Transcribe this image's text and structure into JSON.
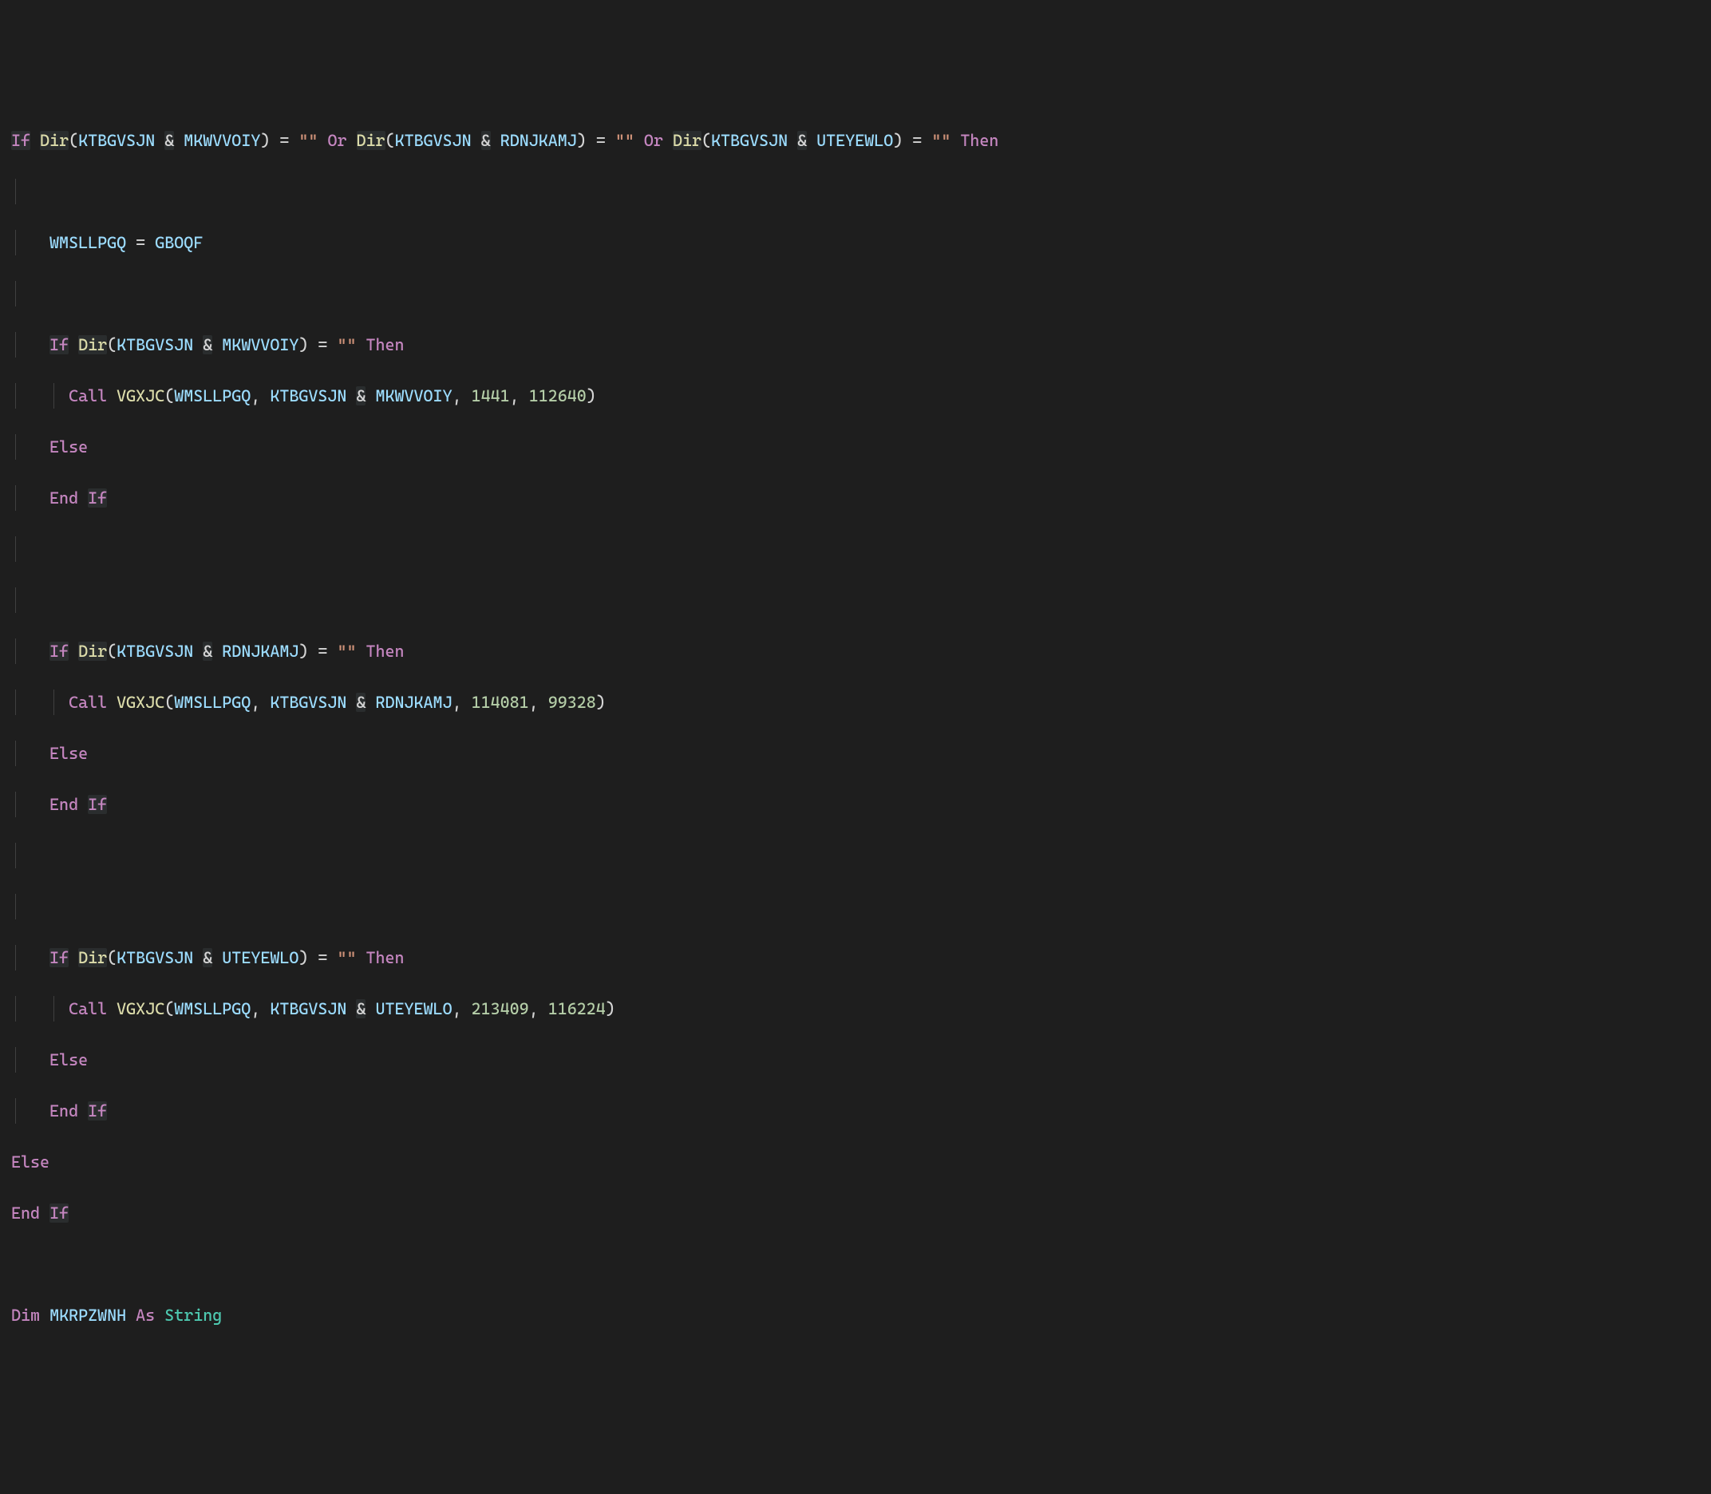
{
  "vars": {
    "KTBGVSJN": "KTBGVSJN",
    "MKWVVOIY": "MKWVVOIY",
    "RDNJKAMJ": "RDNJKAMJ",
    "UTEYEWLO": "UTEYEWLO",
    "WMSLLPGQ": "WMSLLPGQ",
    "GBOQF": "GBOQF",
    "MKRPZWNH": "MKRPZWNH"
  },
  "fn": {
    "Dir": "Dir",
    "VGXJC": "VGXJC"
  },
  "kw": {
    "If": "If",
    "Else": "Else",
    "End": "End",
    "Then": "Then",
    "Or": "Or",
    "Dim": "Dim",
    "As": "As",
    "Call": "Call"
  },
  "type": {
    "String": "String"
  },
  "str": {
    "empty": "\"\""
  },
  "num": {
    "n1441": "1441",
    "n112640": "112640",
    "n114081": "114081",
    "n99328": "99328",
    "n213409": "213409",
    "n116224": "116224"
  },
  "punc": {
    "lpar": "(",
    "rpar": ")",
    "amp": "&",
    "eq": "=",
    "comma": ","
  }
}
